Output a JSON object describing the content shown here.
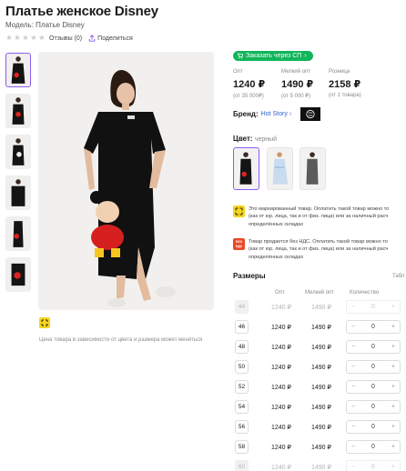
{
  "product": {
    "title": "Платье женское Disney",
    "model": "Модель: Платье Disney",
    "reviews": "Отзывы (0)",
    "share": "Поделиться",
    "color_note": "Цена товара в зависимости от цвета и размера может меняться"
  },
  "order_button": {
    "label": "Заказать через СП"
  },
  "prices": [
    {
      "label": "Опт",
      "value": "1240 ₽",
      "sub": "(от 35 000₽)"
    },
    {
      "label": "Мелкий опт",
      "value": "1490 ₽",
      "sub": "(от 5 000 ₽)"
    },
    {
      "label": "Розница",
      "value": "2158 ₽",
      "sub": "(от 1 товара)"
    }
  ],
  "brand": {
    "label": "Бренд:",
    "name": "Hot Story",
    "logo_text": "HOT STORY"
  },
  "color": {
    "label": "Цвет:",
    "value": "черный"
  },
  "notices": [
    {
      "icon": "marking-icon",
      "lines": [
        "Это маркированный товар. Оплатить такой товар можно то",
        "(как от юр. лица, так и от физ. лица) или за наличный расч",
        "определённых складах"
      ]
    },
    {
      "icon": "no-vat-icon",
      "badge": "БЕЗ НДС",
      "lines": [
        "Товар продается без НДС. Оплатить такой товар можно то",
        "(как от юр. лица, так и от физ. лица) или за наличный расч",
        "определённых складах"
      ]
    }
  ],
  "sizes": {
    "heading": "Размеры",
    "table_link": "Табл",
    "col_opt": "Опт",
    "col_bulk": "Мелкий опт",
    "col_qty": "Количество",
    "rows": [
      {
        "size": "44",
        "opt": "1240 ₽",
        "bulk": "1490 ₽",
        "qty": "0",
        "available": false
      },
      {
        "size": "46",
        "opt": "1240 ₽",
        "bulk": "1490 ₽",
        "qty": "0",
        "available": true
      },
      {
        "size": "48",
        "opt": "1240 ₽",
        "bulk": "1490 ₽",
        "qty": "0",
        "available": true
      },
      {
        "size": "50",
        "opt": "1240 ₽",
        "bulk": "1490 ₽",
        "qty": "0",
        "available": true
      },
      {
        "size": "52",
        "opt": "1240 ₽",
        "bulk": "1490 ₽",
        "qty": "0",
        "available": true
      },
      {
        "size": "54",
        "opt": "1240 ₽",
        "bulk": "1490 ₽",
        "qty": "0",
        "available": true
      },
      {
        "size": "56",
        "opt": "1240 ₽",
        "bulk": "1490 ₽",
        "qty": "0",
        "available": true
      },
      {
        "size": "58",
        "opt": "1240 ₽",
        "bulk": "1490 ₽",
        "qty": "0",
        "available": true
      },
      {
        "size": "60",
        "opt": "1240 ₽",
        "bulk": "1490 ₽",
        "qty": "0",
        "available": false
      }
    ]
  },
  "colors": {
    "accent": "#8a5cf6",
    "green": "#11b55a",
    "link": "#2f64d6",
    "price_grey": "#8a8a8a"
  }
}
